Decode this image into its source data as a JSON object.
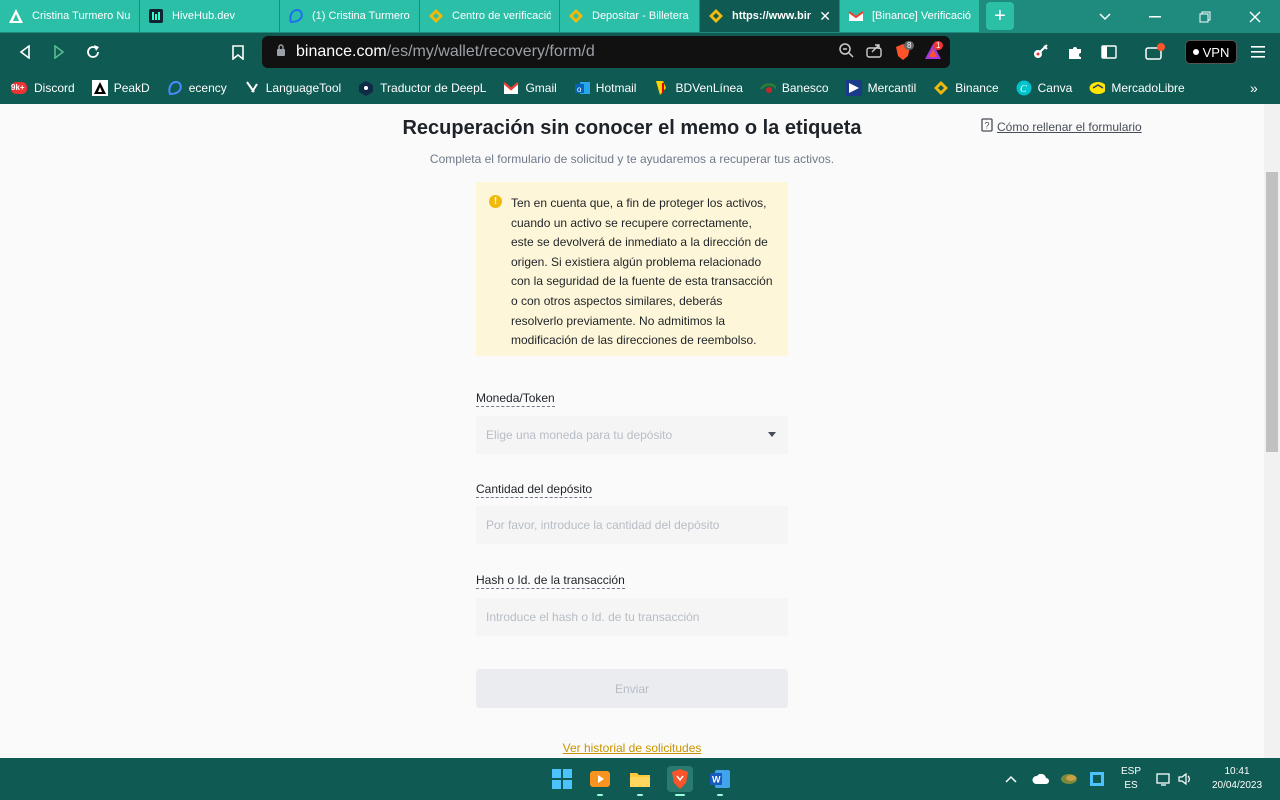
{
  "tabs": [
    {
      "title": "Cristina Turmero Nuñez",
      "icon": "peakd-icon",
      "active": false
    },
    {
      "title": "HiveHub.dev",
      "icon": "hivehub-icon",
      "active": false
    },
    {
      "title": "(1) Cristina Turmero",
      "icon": "ecency-icon",
      "active": false
    },
    {
      "title": "Centro de verificación",
      "icon": "binance-icon",
      "active": false
    },
    {
      "title": "Depositar - Billetera",
      "icon": "binance-icon",
      "active": false
    },
    {
      "title": "https://www.binance",
      "icon": "binance-icon",
      "active": true
    },
    {
      "title": "[Binance] Verificación",
      "icon": "gmail-icon",
      "active": false
    }
  ],
  "toolbar": {
    "url_host": "binance.com",
    "url_path": "/es/my/wallet/recovery/form/d",
    "brave_badge": "8",
    "rewards_badge": "1",
    "vpn_label": "VPN"
  },
  "bookmarks": [
    {
      "label": "Discord",
      "badge": "9k+"
    },
    {
      "label": "PeakD"
    },
    {
      "label": "ecency"
    },
    {
      "label": "LanguageTool"
    },
    {
      "label": "Traductor de DeepL"
    },
    {
      "label": "Gmail"
    },
    {
      "label": "Hotmail"
    },
    {
      "label": "BDVenLínea"
    },
    {
      "label": "Banesco"
    },
    {
      "label": "Mercantil"
    },
    {
      "label": "Binance"
    },
    {
      "label": "Canva"
    },
    {
      "label": "MercadoLibre"
    }
  ],
  "page": {
    "title": "Recuperación sin conocer el memo o la etiqueta",
    "subtitle": "Completa el formulario de solicitud y te ayudaremos a recuperar tus activos.",
    "help_link": "Cómo rellenar el formulario",
    "notice": "Ten en cuenta que, a fin de proteger los activos, cuando un activo se recupere correctamente, este se devolverá de inmediato a la dirección de origen. Si existiera algún problema relacionado con la seguridad de la fuente de esta transacción o con otros aspectos similares, deberás resolverlo previamente. No admitimos la modificación de las direcciones de reembolso.",
    "fields": {
      "coin_label": "Moneda/Token",
      "coin_placeholder": "Elige una moneda para tu depósito",
      "amount_label": "Cantidad del depósito",
      "amount_placeholder": "Por favor, introduce la cantidad del depósito",
      "hash_label": "Hash o Id. de la transacción",
      "hash_placeholder": "Introduce el hash o Id. de tu transacción"
    },
    "submit_label": "Enviar",
    "history_link": "Ver historial de solicitudes"
  },
  "taskbar": {
    "lang_top": "ESP",
    "lang_bottom": "ES",
    "time": "10:41",
    "date": "20/04/2023"
  },
  "colors": {
    "browser_frame": "#0f5a53",
    "tab": "#2bbfa8",
    "binance_yellow": "#f0b90b",
    "notice_bg": "#fef6d8"
  }
}
